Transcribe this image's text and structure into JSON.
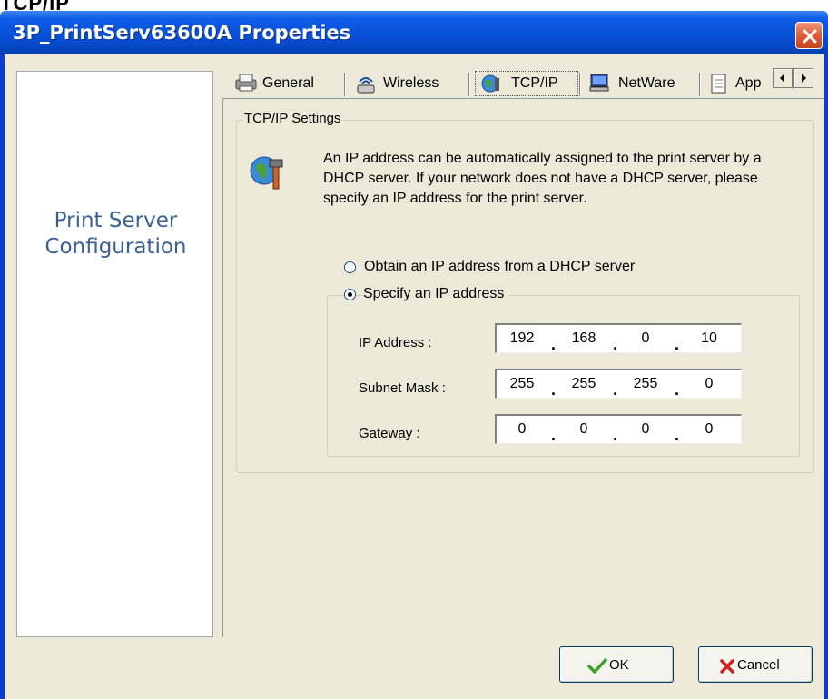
{
  "page_caption": "TCP/IP",
  "window": {
    "title": "3P_PrintServ63600A Properties"
  },
  "left_panel": {
    "title_line1": "Print Server",
    "title_line2": "Configuration"
  },
  "tabs": [
    {
      "label": "General",
      "icon": "printer-icon"
    },
    {
      "label": "Wireless",
      "icon": "wireless-icon"
    },
    {
      "label": "TCP/IP",
      "icon": "network-globe-icon",
      "active": true
    },
    {
      "label": "NetWare",
      "icon": "computer-icon"
    },
    {
      "label": "App",
      "icon": "document-icon"
    }
  ],
  "tcpip": {
    "group_title": "TCP/IP Settings",
    "info": "An IP address can be automatically assigned to the print server by a DHCP server. If your network does not have a DHCP server, please specify an IP address for the print server.",
    "dhcp_option": "Obtain an IP address from a DHCP server",
    "static_option": "Specify an IP address",
    "selected_option": "static",
    "fields": {
      "ip_label": "IP Address :",
      "ip": [
        "192",
        "168",
        "0",
        "10"
      ],
      "subnet_label": "Subnet Mask :",
      "subnet": [
        "255",
        "255",
        "255",
        "0"
      ],
      "gateway_label": "Gateway :",
      "gateway": [
        "0",
        "0",
        "0",
        "0"
      ]
    }
  },
  "buttons": {
    "ok": "OK",
    "cancel": "Cancel"
  },
  "colors": {
    "titlebar": "#0851d8",
    "dialog_bg": "#ece9d8",
    "left_title": "#3a5f91",
    "close_button": "#e0623c"
  }
}
